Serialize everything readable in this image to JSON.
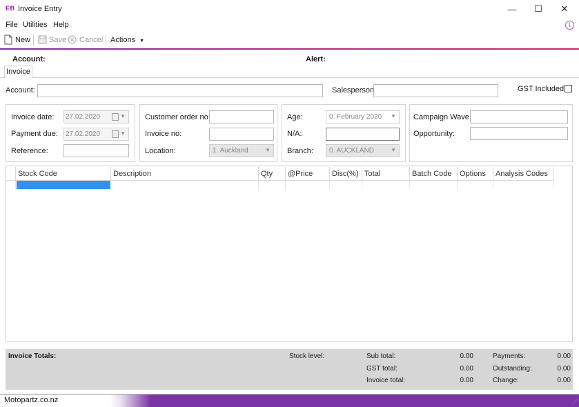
{
  "window": {
    "logo": "EB",
    "title": "Invoice Entry",
    "minimize_glyph": "—",
    "maximize_glyph": "☐",
    "close_glyph": "✕"
  },
  "menu": {
    "file": "File",
    "utilities": "Utilities",
    "help": "Help",
    "info_glyph": "i"
  },
  "toolbar": {
    "new": "New",
    "save": "Save",
    "cancel": "Cancel",
    "actions": "Actions"
  },
  "header": {
    "account_label": "Account:",
    "alert_label": "Alert:"
  },
  "tabs": {
    "invoice": "Invoice"
  },
  "top_fields": {
    "account_label": "Account:",
    "salesperson_label": "Salesperson:",
    "gst_included_label": "GST Included:"
  },
  "panel_dates": {
    "invoice_date_label": "Invoice date:",
    "invoice_date_value": "27.02.2020",
    "payment_due_label": "Payment due:",
    "payment_due_value": "27.02.2020",
    "reference_label": "Reference:"
  },
  "panel_order": {
    "customer_order_label": "Customer order no:",
    "invoice_no_label": "Invoice no:",
    "location_label": "Location:",
    "location_value": "1. Auckland"
  },
  "panel_age": {
    "age_label": "Age:",
    "age_value": "0. February 2020",
    "na_label": "N/A:",
    "branch_label": "Branch:",
    "branch_value": "0. AUCKLAND"
  },
  "panel_campaign": {
    "campaign_label": "Campaign Wave:",
    "opportunity_label": "Opportunity:"
  },
  "grid": {
    "columns": [
      "Stock Code",
      "Description",
      "Qty",
      "@Price",
      "Disc(%)",
      "Total",
      "Batch Code",
      "Options",
      "Analysis Codes"
    ]
  },
  "totals": {
    "heading": "Invoice Totals:",
    "stock_level_label": "Stock level:",
    "sub_total_label": "Sub total:",
    "sub_total_value": "0.00",
    "gst_total_label": "GST total:",
    "gst_total_value": "0.00",
    "invoice_total_label": "Invoice total:",
    "invoice_total_value": "0.00",
    "payments_label": "Payments:",
    "payments_value": "0.00",
    "outstanding_label": "Outstanding:",
    "outstanding_value": "0.00",
    "change_label": "Change:",
    "change_value": "0.00"
  },
  "status": {
    "company": "Motopartz.co.nz"
  },
  "colors": {
    "accent_purple": "#7b34a6",
    "selection_blue": "#2e92f0",
    "totals_bg": "#d6d6d6"
  }
}
